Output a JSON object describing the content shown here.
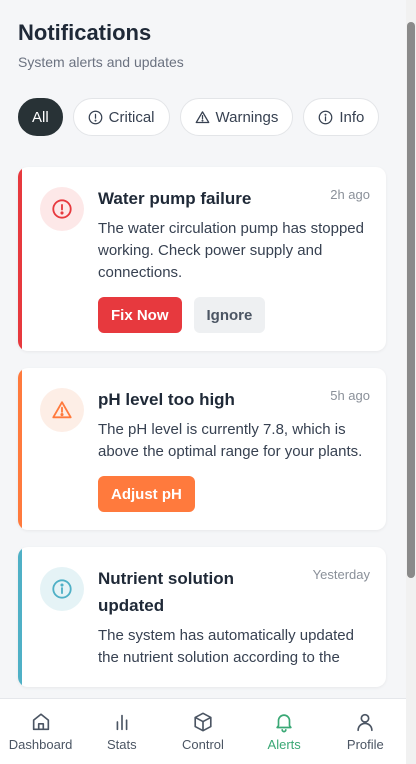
{
  "header": {
    "title": "Notifications",
    "subtitle": "System alerts and updates"
  },
  "filters": [
    {
      "label": "All",
      "icon": "none",
      "active": true
    },
    {
      "label": "Critical",
      "icon": "alert-circle-icon",
      "active": false
    },
    {
      "label": "Warnings",
      "icon": "warning-triangle-icon",
      "active": false
    },
    {
      "label": "Info",
      "icon": "info-circle-icon",
      "active": false
    }
  ],
  "notifications": [
    {
      "title": "Water pump failure",
      "time": "2h ago",
      "body": "The water circulation pump has stopped working. Check power supply and connections.",
      "severity": "critical",
      "accent": "#e7393e",
      "icon_bg": "#fde8e8",
      "icon": "alert-circle-icon",
      "actions": [
        "Fix Now",
        "Ignore"
      ]
    },
    {
      "title": "pH level too high",
      "time": "5h ago",
      "body": "The pH level is currently 7.8, which is above the optimal range for your plants.",
      "severity": "warning",
      "accent": "#ff7a3d",
      "icon_bg": "#fdeee6",
      "icon": "warning-triangle-icon",
      "actions": [
        "Adjust pH"
      ]
    },
    {
      "title": "Nutrient solution updated",
      "time": "Yesterday",
      "body": "The system has automatically updated the nutrient solution according to the",
      "severity": "info",
      "accent": "#4fb0c6",
      "icon_bg": "#e5f3f6",
      "icon": "info-circle-icon",
      "actions": []
    }
  ],
  "bottom_nav": [
    {
      "label": "Dashboard",
      "icon": "home-icon",
      "active": false
    },
    {
      "label": "Stats",
      "icon": "bar-chart-icon",
      "active": false
    },
    {
      "label": "Control",
      "icon": "cube-icon",
      "active": false
    },
    {
      "label": "Alerts",
      "icon": "bell-icon",
      "active": true
    },
    {
      "label": "Profile",
      "icon": "user-icon",
      "active": false
    }
  ],
  "colors": {
    "active_nav": "#3aa875",
    "chip_active_bg": "#283236"
  }
}
